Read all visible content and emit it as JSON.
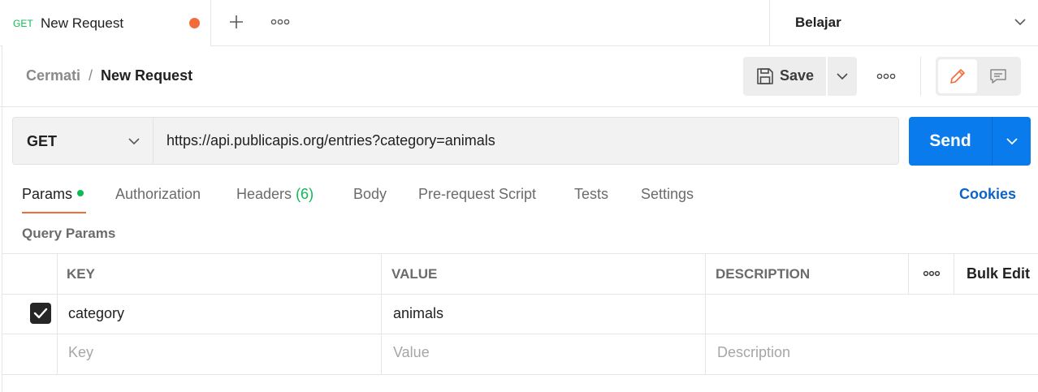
{
  "tab": {
    "method": "GET",
    "title": "New Request"
  },
  "environment": {
    "label": "Belajar"
  },
  "breadcrumb": {
    "parent": "Cermati",
    "separator": "/",
    "current": "New Request"
  },
  "header": {
    "save_label": "Save"
  },
  "request": {
    "method": "GET",
    "url": "https://api.publicapis.org/entries?category=animals",
    "send_label": "Send"
  },
  "request_tabs": {
    "params": "Params",
    "authorization": "Authorization",
    "headers": "Headers",
    "headers_count": "(6)",
    "body": "Body",
    "prerequest": "Pre-request Script",
    "tests": "Tests",
    "settings": "Settings",
    "cookies": "Cookies"
  },
  "query_params": {
    "section_label": "Query Params",
    "columns": {
      "key": "KEY",
      "value": "VALUE",
      "description": "DESCRIPTION"
    },
    "bulk_edit": "Bulk Edit",
    "rows": [
      {
        "checked": true,
        "key": "category",
        "value": "animals",
        "description": ""
      }
    ],
    "placeholders": {
      "key": "Key",
      "value": "Value",
      "description": "Description"
    }
  },
  "colors": {
    "send": "#097bed",
    "accent": "#f26b3a",
    "get": "#0cbb52",
    "link": "#0b64c8"
  }
}
